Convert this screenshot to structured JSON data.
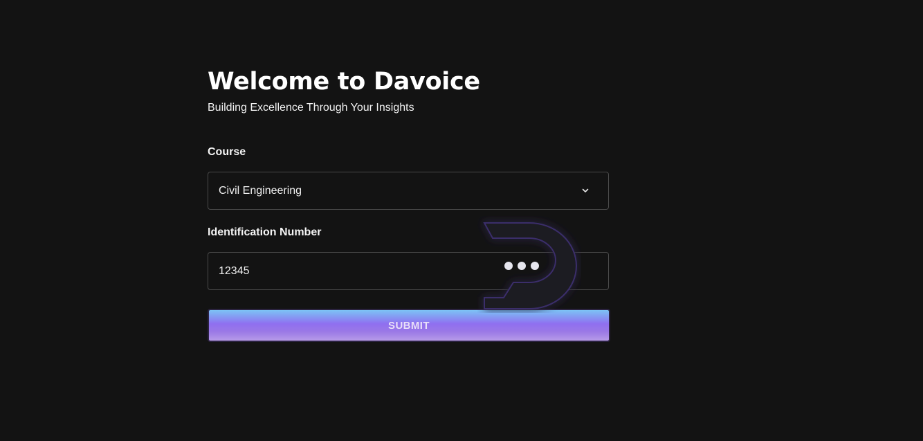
{
  "header": {
    "title": "Welcome to Davoice",
    "subtitle": "Building Excellence Through Your Insights"
  },
  "form": {
    "course_label": "Course",
    "course_value": "Civil Engineering",
    "id_label": "Identification Number",
    "id_value": "12345",
    "submit_label": "SUBMIT"
  },
  "colors": {
    "background": "#131313",
    "button_gradient_top": "#7cc3f5",
    "button_gradient_bottom": "#9a78e6",
    "logo_glow": "#7b5cd6"
  },
  "icons": {
    "course_dropdown": "chevron-down-icon",
    "watermark": "davoice-logo-icon"
  }
}
